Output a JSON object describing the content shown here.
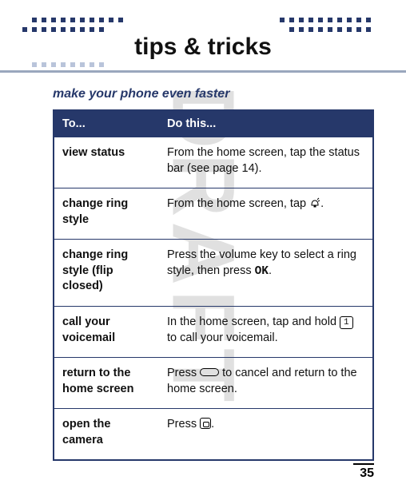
{
  "watermark": "DRAFT",
  "heading": "tips & tricks",
  "subhead": "make your phone even faster",
  "table": {
    "head": {
      "c1": "To...",
      "c2": "Do this..."
    },
    "rows": [
      {
        "c1": "view status",
        "c2a": "From the home screen, tap the status bar (see page 14)."
      },
      {
        "c1": "change ring style",
        "c2a": "From the home screen, tap ",
        "icon": "ring-icon",
        "c2b": "."
      },
      {
        "c1": "change ring style (flip closed)",
        "c2a": "Press the volume key to select a ring style, then press ",
        "mono": "OK",
        "c2b": "."
      },
      {
        "c1": "call your voicemail",
        "c2a": "In the home screen, tap and hold ",
        "key": "1",
        "c2b": " to call your voicemail."
      },
      {
        "c1": "return to the home screen",
        "c2a": "Press ",
        "pill": true,
        "c2b": " to cancel and return to the home screen."
      },
      {
        "c1": "open the camera",
        "c2a": "Press ",
        "cam": true,
        "c2b": "."
      }
    ]
  },
  "page_number": "35"
}
